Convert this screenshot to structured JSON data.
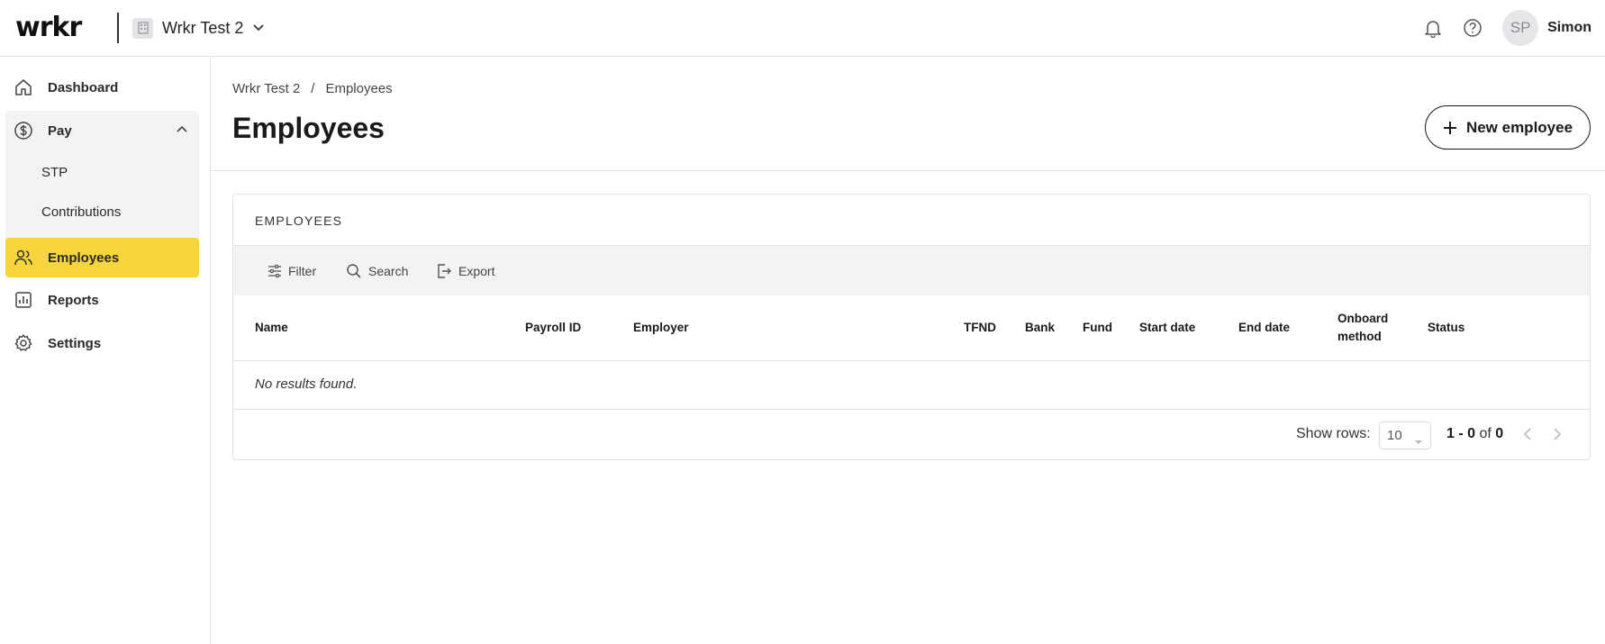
{
  "header": {
    "logo_text": "wrkr",
    "org_name": "Wrkr Test 2",
    "user_initials": "SP",
    "user_name": "Simon"
  },
  "sidebar": {
    "items": [
      {
        "label": "Dashboard",
        "icon": "home-icon"
      },
      {
        "label": "Pay",
        "icon": "dollar-circle-icon"
      },
      {
        "label": "STP"
      },
      {
        "label": "Contributions"
      },
      {
        "label": "Employees",
        "icon": "users-icon",
        "active": true
      },
      {
        "label": "Reports",
        "icon": "chart-icon"
      },
      {
        "label": "Settings",
        "icon": "gear-icon"
      }
    ]
  },
  "breadcrumb": {
    "items": [
      "Wrkr Test 2",
      "Employees"
    ],
    "separator": "/"
  },
  "page": {
    "title": "Employees",
    "new_button_label": "New employee"
  },
  "card": {
    "title": "EMPLOYEES",
    "toolbar": {
      "filter": "Filter",
      "search": "Search",
      "export": "Export"
    },
    "columns": [
      "Name",
      "Payroll ID",
      "Employer",
      "TFND",
      "Bank",
      "Fund",
      "Start date",
      "End date",
      "Onboard method",
      "Status"
    ],
    "empty_text": "No results found.",
    "footer": {
      "show_rows_label": "Show rows:",
      "rows_value": "10",
      "range_from": "1",
      "range_dash": "-",
      "range_to": "0",
      "range_of": "of",
      "range_total": "0"
    }
  },
  "colors": {
    "accent": "#f5d53b",
    "sidebar_group_bg": "#f3f3f3",
    "toolbar_bg": "#f3f3f3",
    "border": "#e2e2e2"
  }
}
